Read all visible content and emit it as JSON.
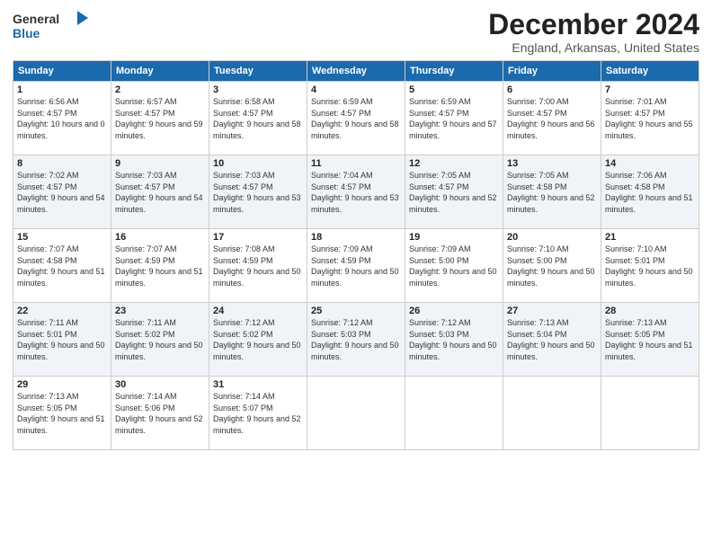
{
  "logo": {
    "line1": "General",
    "line2": "Blue"
  },
  "title": "December 2024",
  "subtitle": "England, Arkansas, United States",
  "days_header": [
    "Sunday",
    "Monday",
    "Tuesday",
    "Wednesday",
    "Thursday",
    "Friday",
    "Saturday"
  ],
  "weeks": [
    [
      {
        "day": "1",
        "sunrise": "Sunrise: 6:56 AM",
        "sunset": "Sunset: 4:57 PM",
        "daylight": "Daylight: 10 hours and 0 minutes."
      },
      {
        "day": "2",
        "sunrise": "Sunrise: 6:57 AM",
        "sunset": "Sunset: 4:57 PM",
        "daylight": "Daylight: 9 hours and 59 minutes."
      },
      {
        "day": "3",
        "sunrise": "Sunrise: 6:58 AM",
        "sunset": "Sunset: 4:57 PM",
        "daylight": "Daylight: 9 hours and 58 minutes."
      },
      {
        "day": "4",
        "sunrise": "Sunrise: 6:59 AM",
        "sunset": "Sunset: 4:57 PM",
        "daylight": "Daylight: 9 hours and 58 minutes."
      },
      {
        "day": "5",
        "sunrise": "Sunrise: 6:59 AM",
        "sunset": "Sunset: 4:57 PM",
        "daylight": "Daylight: 9 hours and 57 minutes."
      },
      {
        "day": "6",
        "sunrise": "Sunrise: 7:00 AM",
        "sunset": "Sunset: 4:57 PM",
        "daylight": "Daylight: 9 hours and 56 minutes."
      },
      {
        "day": "7",
        "sunrise": "Sunrise: 7:01 AM",
        "sunset": "Sunset: 4:57 PM",
        "daylight": "Daylight: 9 hours and 55 minutes."
      }
    ],
    [
      {
        "day": "8",
        "sunrise": "Sunrise: 7:02 AM",
        "sunset": "Sunset: 4:57 PM",
        "daylight": "Daylight: 9 hours and 54 minutes."
      },
      {
        "day": "9",
        "sunrise": "Sunrise: 7:03 AM",
        "sunset": "Sunset: 4:57 PM",
        "daylight": "Daylight: 9 hours and 54 minutes."
      },
      {
        "day": "10",
        "sunrise": "Sunrise: 7:03 AM",
        "sunset": "Sunset: 4:57 PM",
        "daylight": "Daylight: 9 hours and 53 minutes."
      },
      {
        "day": "11",
        "sunrise": "Sunrise: 7:04 AM",
        "sunset": "Sunset: 4:57 PM",
        "daylight": "Daylight: 9 hours and 53 minutes."
      },
      {
        "day": "12",
        "sunrise": "Sunrise: 7:05 AM",
        "sunset": "Sunset: 4:57 PM",
        "daylight": "Daylight: 9 hours and 52 minutes."
      },
      {
        "day": "13",
        "sunrise": "Sunrise: 7:05 AM",
        "sunset": "Sunset: 4:58 PM",
        "daylight": "Daylight: 9 hours and 52 minutes."
      },
      {
        "day": "14",
        "sunrise": "Sunrise: 7:06 AM",
        "sunset": "Sunset: 4:58 PM",
        "daylight": "Daylight: 9 hours and 51 minutes."
      }
    ],
    [
      {
        "day": "15",
        "sunrise": "Sunrise: 7:07 AM",
        "sunset": "Sunset: 4:58 PM",
        "daylight": "Daylight: 9 hours and 51 minutes."
      },
      {
        "day": "16",
        "sunrise": "Sunrise: 7:07 AM",
        "sunset": "Sunset: 4:59 PM",
        "daylight": "Daylight: 9 hours and 51 minutes."
      },
      {
        "day": "17",
        "sunrise": "Sunrise: 7:08 AM",
        "sunset": "Sunset: 4:59 PM",
        "daylight": "Daylight: 9 hours and 50 minutes."
      },
      {
        "day": "18",
        "sunrise": "Sunrise: 7:09 AM",
        "sunset": "Sunset: 4:59 PM",
        "daylight": "Daylight: 9 hours and 50 minutes."
      },
      {
        "day": "19",
        "sunrise": "Sunrise: 7:09 AM",
        "sunset": "Sunset: 5:00 PM",
        "daylight": "Daylight: 9 hours and 50 minutes."
      },
      {
        "day": "20",
        "sunrise": "Sunrise: 7:10 AM",
        "sunset": "Sunset: 5:00 PM",
        "daylight": "Daylight: 9 hours and 50 minutes."
      },
      {
        "day": "21",
        "sunrise": "Sunrise: 7:10 AM",
        "sunset": "Sunset: 5:01 PM",
        "daylight": "Daylight: 9 hours and 50 minutes."
      }
    ],
    [
      {
        "day": "22",
        "sunrise": "Sunrise: 7:11 AM",
        "sunset": "Sunset: 5:01 PM",
        "daylight": "Daylight: 9 hours and 50 minutes."
      },
      {
        "day": "23",
        "sunrise": "Sunrise: 7:11 AM",
        "sunset": "Sunset: 5:02 PM",
        "daylight": "Daylight: 9 hours and 50 minutes."
      },
      {
        "day": "24",
        "sunrise": "Sunrise: 7:12 AM",
        "sunset": "Sunset: 5:02 PM",
        "daylight": "Daylight: 9 hours and 50 minutes."
      },
      {
        "day": "25",
        "sunrise": "Sunrise: 7:12 AM",
        "sunset": "Sunset: 5:03 PM",
        "daylight": "Daylight: 9 hours and 50 minutes."
      },
      {
        "day": "26",
        "sunrise": "Sunrise: 7:12 AM",
        "sunset": "Sunset: 5:03 PM",
        "daylight": "Daylight: 9 hours and 50 minutes."
      },
      {
        "day": "27",
        "sunrise": "Sunrise: 7:13 AM",
        "sunset": "Sunset: 5:04 PM",
        "daylight": "Daylight: 9 hours and 50 minutes."
      },
      {
        "day": "28",
        "sunrise": "Sunrise: 7:13 AM",
        "sunset": "Sunset: 5:05 PM",
        "daylight": "Daylight: 9 hours and 51 minutes."
      }
    ],
    [
      {
        "day": "29",
        "sunrise": "Sunrise: 7:13 AM",
        "sunset": "Sunset: 5:05 PM",
        "daylight": "Daylight: 9 hours and 51 minutes."
      },
      {
        "day": "30",
        "sunrise": "Sunrise: 7:14 AM",
        "sunset": "Sunset: 5:06 PM",
        "daylight": "Daylight: 9 hours and 52 minutes."
      },
      {
        "day": "31",
        "sunrise": "Sunrise: 7:14 AM",
        "sunset": "Sunset: 5:07 PM",
        "daylight": "Daylight: 9 hours and 52 minutes."
      },
      null,
      null,
      null,
      null
    ]
  ]
}
